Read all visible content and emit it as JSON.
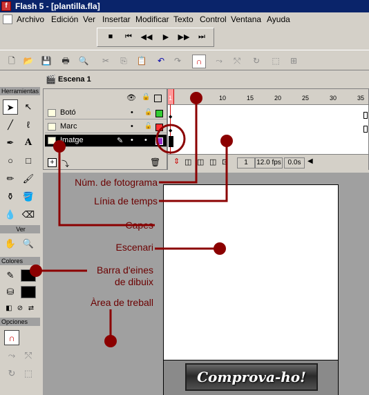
{
  "window": {
    "title": "Flash 5 - [plantilla.fla]"
  },
  "menu": [
    "Archivo",
    "Edición",
    "Ver",
    "Insertar",
    "Modificar",
    "Texto",
    "Control",
    "Ventana",
    "Ayuda"
  ],
  "controller": [
    "■",
    "⏮",
    "◀◀",
    "▶",
    "▶▶",
    "⏭"
  ],
  "toolbar_icons": [
    "new-icon",
    "open-icon",
    "save-icon",
    "print-icon",
    "print-preview-icon",
    "cut-icon",
    "copy-icon",
    "paste-icon",
    "undo-icon",
    "redo-icon",
    "snap-icon",
    "smooth-icon",
    "straighten-icon",
    "rotate-icon",
    "scale-icon",
    "align-icon"
  ],
  "scene": {
    "label": "Escena 1"
  },
  "tools": {
    "header": "Herramientas",
    "view_header": "Ver",
    "colors_header": "Colores",
    "options_header": "Opciones"
  },
  "timeline": {
    "layers": [
      {
        "name": "Botó",
        "color": "#33cc33"
      },
      {
        "name": "Marc",
        "color": "#ff3333"
      },
      {
        "name": "Imatge",
        "color": "#9933cc",
        "selected": true
      }
    ],
    "ruler_ticks": [
      "1",
      "5",
      "10",
      "15",
      "20",
      "25",
      "30",
      "35"
    ],
    "status": {
      "frame": "1",
      "fps": "12.0 fps",
      "time": "0.0s"
    }
  },
  "button": {
    "label": "Comprova-ho!"
  },
  "annotations": {
    "frame_number": "Núm. de fotograma",
    "timeline": "Línia de temps",
    "layers": "Capes",
    "stage": "Escenari",
    "drawing_toolbar_line1": "Barra d'eines",
    "drawing_toolbar_line2": "de dibuix",
    "work_area": "Àrea de treball"
  },
  "colors": {
    "annotation": "#8b0000",
    "title_bar": "#0a246a",
    "selected_layer": "#000000"
  }
}
